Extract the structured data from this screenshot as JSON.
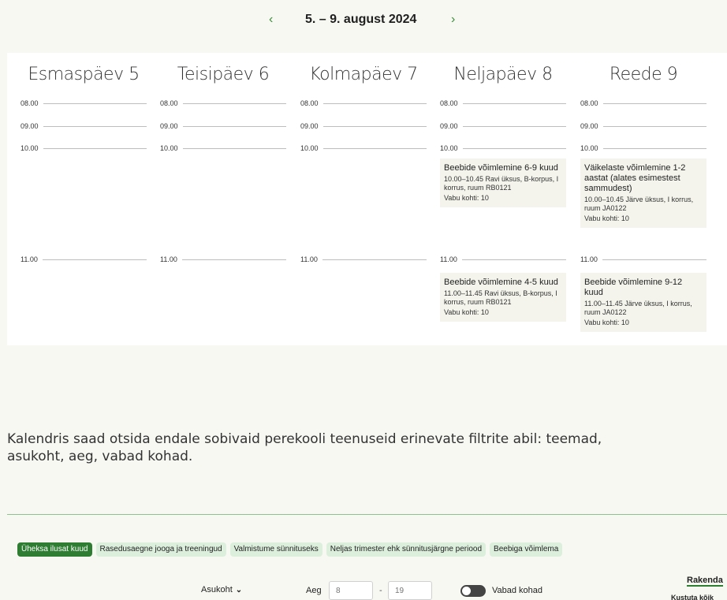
{
  "week_nav": {
    "title": "5. – 9. august 2024",
    "prev_icon": "‹",
    "next_icon": "›"
  },
  "calendar": {
    "days": [
      {
        "header": "Esmaspäev 5",
        "times": [
          "08.00",
          "09.00",
          "10.00",
          "11.00"
        ],
        "events": []
      },
      {
        "header": "Teisipäev 6",
        "times": [
          "08.00",
          "09.00",
          "10.00",
          "11.00"
        ],
        "events": []
      },
      {
        "header": "Kolmapäev 7",
        "times": [
          "08.00",
          "09.00",
          "10.00",
          "11.00"
        ],
        "events": []
      },
      {
        "header": "Neljapäev 8",
        "times": [
          "08.00",
          "09.00",
          "10.00",
          "11.00"
        ],
        "events": [
          {
            "title": "Beebide võimlemine 6-9 kuud",
            "meta": "10.00–10.45 Ravi üksus, B-korpus, I korrus, ruum RB0121",
            "spots": "Vabu kohti:  10"
          },
          {
            "title": "Beebide võimlemine 4-5 kuud",
            "meta": "11.00–11.45 Ravi üksus, B-korpus, I korrus, ruum RB0121",
            "spots": "Vabu kohti:  10"
          }
        ]
      },
      {
        "header": "Reede 9",
        "times": [
          "08.00",
          "09.00",
          "10.00",
          "11.00"
        ],
        "events": [
          {
            "title": "Väikelaste võimlemine 1-2 aastat (alates esimestest sammudest)",
            "meta": "10.00–10.45 Järve üksus, I korrus, ruum JA0122",
            "spots": "Vabu kohti:  10"
          },
          {
            "title": "Beebide võimlemine 9-12 kuud",
            "meta": "11.00–11.45 Järve üksus, I korrus, ruum JA0122",
            "spots": "Vabu kohti:  10"
          }
        ]
      }
    ]
  },
  "info_text": "Kalendris saad otsida endale sobivaid perekooli teenuseid erinevate filtrite abil: teemad, asukoht, aeg, vabad kohad.",
  "tags": [
    {
      "label": "Üheksa ilusat kuud",
      "active": true
    },
    {
      "label": "Rasedusaegne jooga ja treeningud",
      "active": false
    },
    {
      "label": "Valmistume sünnituseks",
      "active": false
    },
    {
      "label": "Neljas trimester ehk sünnitusjärgne periood",
      "active": false
    },
    {
      "label": "Beebiga võimlema",
      "active": false
    }
  ],
  "filters": {
    "location_label": "Asukoht",
    "time_label": "Aeg",
    "time_min_placeholder": "8",
    "time_max_placeholder": "19",
    "dash": "-",
    "free_spots_label": "Vabad kohad",
    "apply_label": "Rakenda",
    "clear_label": "Kustuta kõik"
  },
  "colors": {
    "accent": "#2e7d32",
    "tag_bg": "#dcefdc",
    "page_bg": "#f8f8f3"
  }
}
